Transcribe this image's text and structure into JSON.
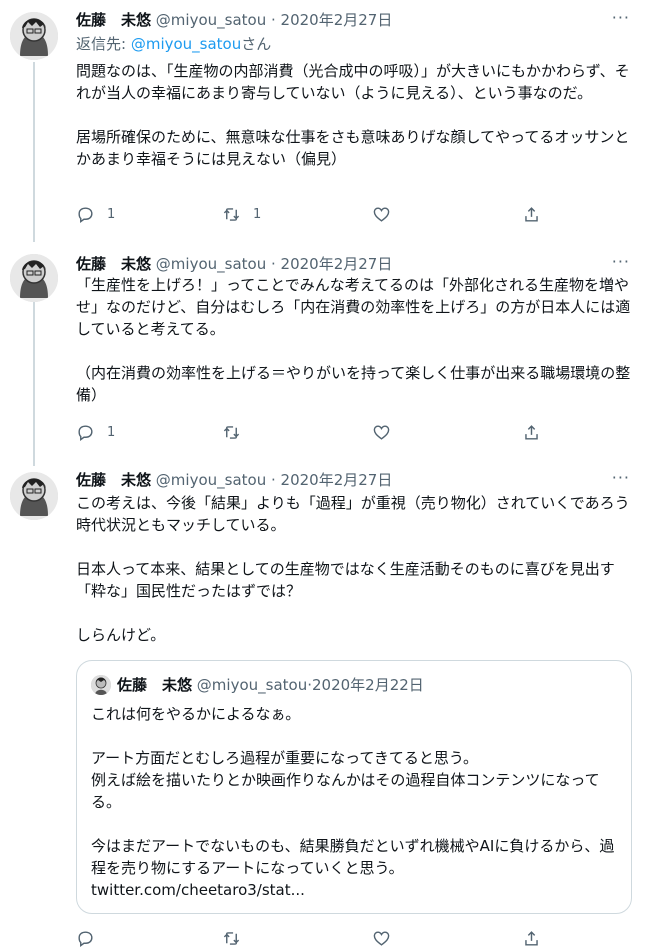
{
  "tweets": [
    {
      "name": "佐藤　未悠",
      "handle": "@miyou_satou",
      "dot": " · ",
      "date": "2020年2月27日",
      "reply_prefix": "返信先: ",
      "reply_handle": "@miyou_satou",
      "reply_suffix": "さん",
      "paragraphs": [
        "問題なのは、「生産物の内部消費（光合成中の呼吸）」が大きいにもかかわらず、それが当人の幸福にあまり寄与していない（ように見える）、という事なのだ。",
        "居場所確保のために、無意味な仕事をさも意味ありげな顔してやってるオッサンとかあまり幸福そうには見えない（偏見）"
      ],
      "reply_count": "1",
      "retweet_count": "1",
      "like_count": "",
      "more": "···"
    },
    {
      "name": "佐藤　未悠",
      "handle": "@miyou_satou",
      "dot": " · ",
      "date": "2020年2月27日",
      "paragraphs": [
        "「生産性を上げろ！」ってことでみんな考えてるのは「外部化される生産物を増やせ」なのだけど、自分はむしろ「内在消費の効率性を上げろ」の方が日本人には適していると考えてる。",
        "（内在消費の効率性を上げる＝やりがいを持って楽しく仕事が出来る職場環境の整備）"
      ],
      "reply_count": "1",
      "retweet_count": "",
      "like_count": "",
      "more": "···"
    },
    {
      "name": "佐藤　未悠",
      "handle": "@miyou_satou",
      "dot": " · ",
      "date": "2020年2月27日",
      "paragraphs": [
        "この考えは、今後「結果」よりも「過程」が重視（売り物化）されていくであろう時代状況ともマッチしている。",
        "日本人って本来、結果としての生産物ではなく生産活動そのものに喜びを見出す「粋な」国民性だったはずでは？",
        "しらんけど。"
      ],
      "reply_count": "",
      "retweet_count": "",
      "like_count": "",
      "more": "···"
    }
  ],
  "quote": {
    "name": "佐藤　未悠",
    "handle": "@miyou_satou",
    "dot": " · ",
    "date": "2020年2月22日",
    "paragraphs": [
      "これは何をやるかによるなぁ。",
      "アート方面だとむしろ過程が重要になってきてると思う。\n例えば絵を描いたりとか映画作りなんかはその過程自体コンテンツになってる。",
      "今はまだアートでないものも、結果勝負だといずれ機械やAIに負けるから、過程を売り物にするアートになっていくと思う。"
    ],
    "link": "twitter.com/cheetaro3/stat..."
  },
  "icons": {
    "reply": "reply-icon",
    "retweet": "retweet-icon",
    "like": "heart-icon",
    "share": "share-icon",
    "more": "more-icon"
  },
  "colors": {
    "link": "#1d9bf0",
    "meta": "#536471",
    "text": "#0f1419",
    "border": "#cfd9de"
  }
}
